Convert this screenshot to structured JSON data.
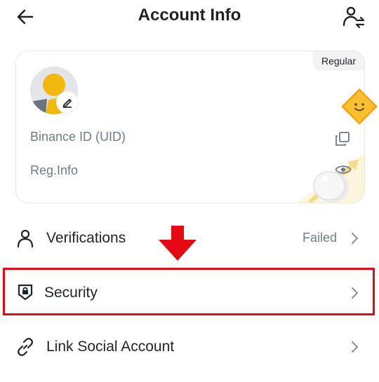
{
  "header": {
    "title": "Account Info",
    "back_icon": "arrow-left-icon",
    "switch_icon": "user-switch-icon"
  },
  "card": {
    "badge": "Regular",
    "uid_label": "Binance ID (UID)",
    "reg_label": "Reg.Info",
    "copy_icon": "copy-icon",
    "eye_icon": "eye-icon",
    "edit_icon": "pencil-icon"
  },
  "rows": [
    {
      "label": "Verifications",
      "status": "Failed",
      "icon": "person-icon"
    },
    {
      "label": "Security",
      "status": "",
      "icon": "shield-lock-icon"
    },
    {
      "label": "Link Social Account",
      "status": "",
      "icon": "link-icon"
    }
  ],
  "colors": {
    "highlight": "#e50914",
    "accent": "#f0b90b",
    "text": "#1e2329",
    "muted": "#707a8a"
  }
}
